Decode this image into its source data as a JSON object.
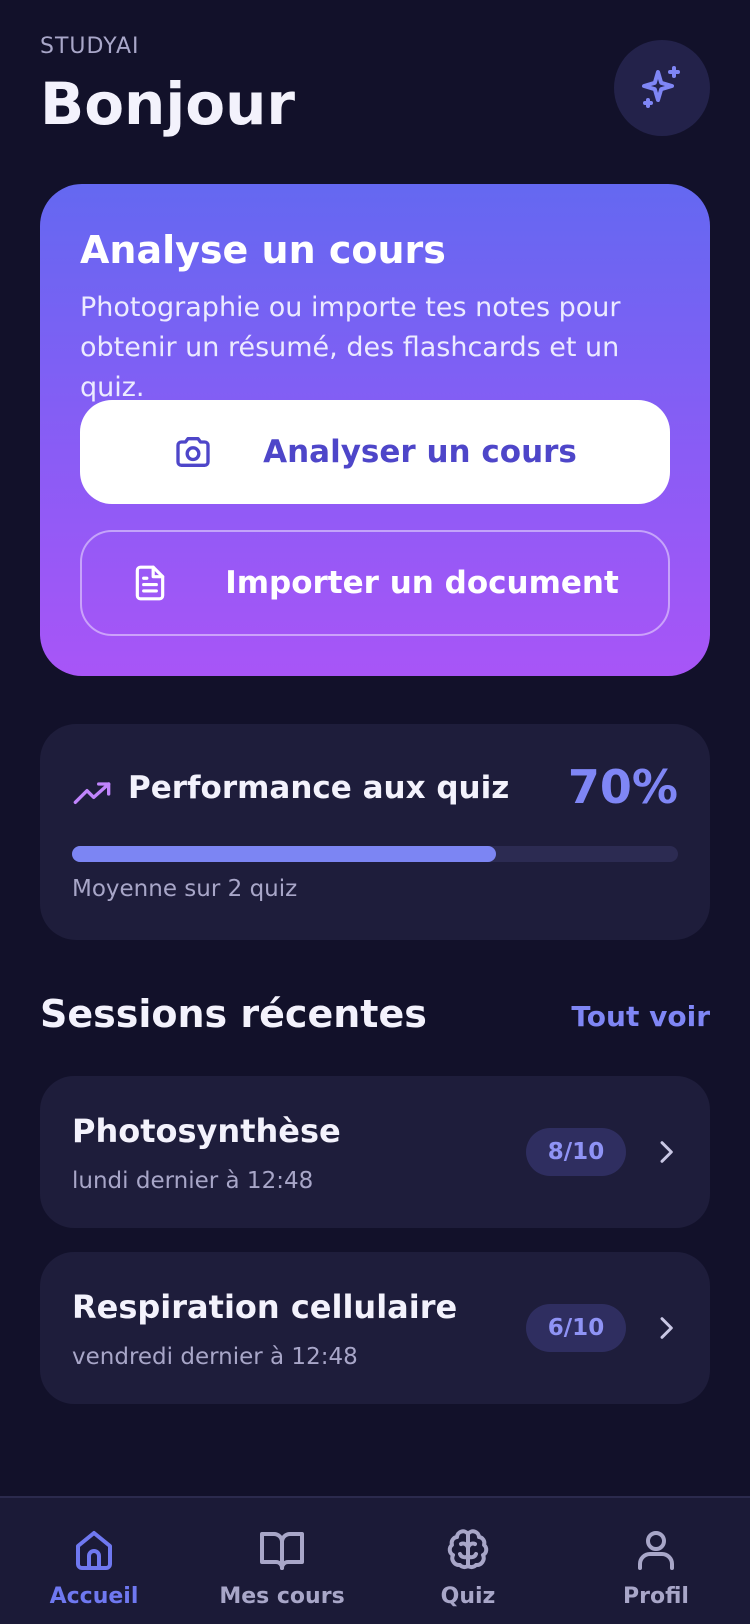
{
  "header": {
    "brand": "STUDYAI",
    "greeting": "Bonjour",
    "magic_icon": "sparkles-icon"
  },
  "hero": {
    "title": "Analyse un cours",
    "description": "Photographie ou importe tes notes pour obtenir un résumé, des flashcards et un quiz.",
    "primary_button": {
      "label": "Analyser un cours",
      "icon": "camera-icon"
    },
    "secondary_button": {
      "label": "Importer un document",
      "icon": "document-icon"
    }
  },
  "performance": {
    "icon": "trending-up-icon",
    "title": "Performance aux quiz",
    "value_label": "70%",
    "progress": 0.7,
    "subtitle": "Moyenne sur 2 quiz"
  },
  "sessions": {
    "title": "Sessions récentes",
    "see_all": "Tout voir",
    "items": [
      {
        "title": "Photosynthèse",
        "date": "lundi dernier à 12:48",
        "score": "8/10"
      },
      {
        "title": "Respiration cellulaire",
        "date": "vendredi dernier à 12:48",
        "score": "6/10"
      }
    ]
  },
  "nav": {
    "items": [
      {
        "label": "Accueil",
        "icon": "home-icon",
        "active": true
      },
      {
        "label": "Mes cours",
        "icon": "book-open-icon",
        "active": false
      },
      {
        "label": "Quiz",
        "icon": "brain-icon",
        "active": false
      },
      {
        "label": "Profil",
        "icon": "user-icon",
        "active": false
      }
    ]
  },
  "colors": {
    "background": "#12112a",
    "card": "#1e1d3b",
    "accent": "#7f86f5",
    "hero_gradient_start": "#6468f1",
    "hero_gradient_end": "#a855f7"
  }
}
